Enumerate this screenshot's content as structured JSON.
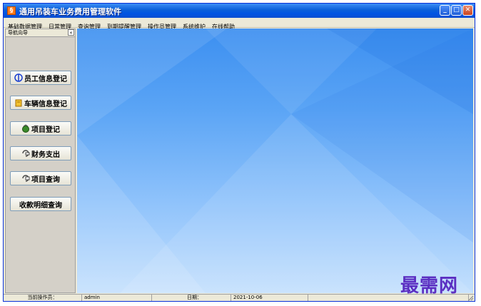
{
  "window": {
    "title": "通用吊装车业务费用管理软件",
    "app_icon": "app-icon",
    "controls": [
      "minimize-icon",
      "maximize-icon",
      "close-icon"
    ]
  },
  "menubar": {
    "items": [
      "基础数据管理",
      "日常管理",
      "查询管理",
      "到期提醒管理",
      "操作员管理",
      "系统维护",
      "在线帮助"
    ]
  },
  "sidebar": {
    "title": "导航向导",
    "collapse_label": "«",
    "buttons": [
      {
        "label": "员工信息登记",
        "icon": "employee-icon"
      },
      {
        "label": "车辆信息登记",
        "icon": "vehicle-icon"
      },
      {
        "label": "项目登记",
        "icon": "project-icon"
      },
      {
        "label": "财务支出",
        "icon": "finance-icon"
      },
      {
        "label": "项目查询",
        "icon": "query-icon"
      },
      {
        "label": "收款明细查询",
        "icon": ""
      }
    ]
  },
  "statusbar": {
    "operator_label": "当前操作员：",
    "operator_value": "admin",
    "date_label": "日期：",
    "date_value": "2021-10-06"
  },
  "watermark": "最需网",
  "colors": {
    "title_bar": "#0054e3",
    "desktop_top": "#3c8ff0",
    "desktop_bottom": "#c4e0fd",
    "sidebar_bg": "#d4d0c8",
    "watermark": "#5b2fc2"
  }
}
